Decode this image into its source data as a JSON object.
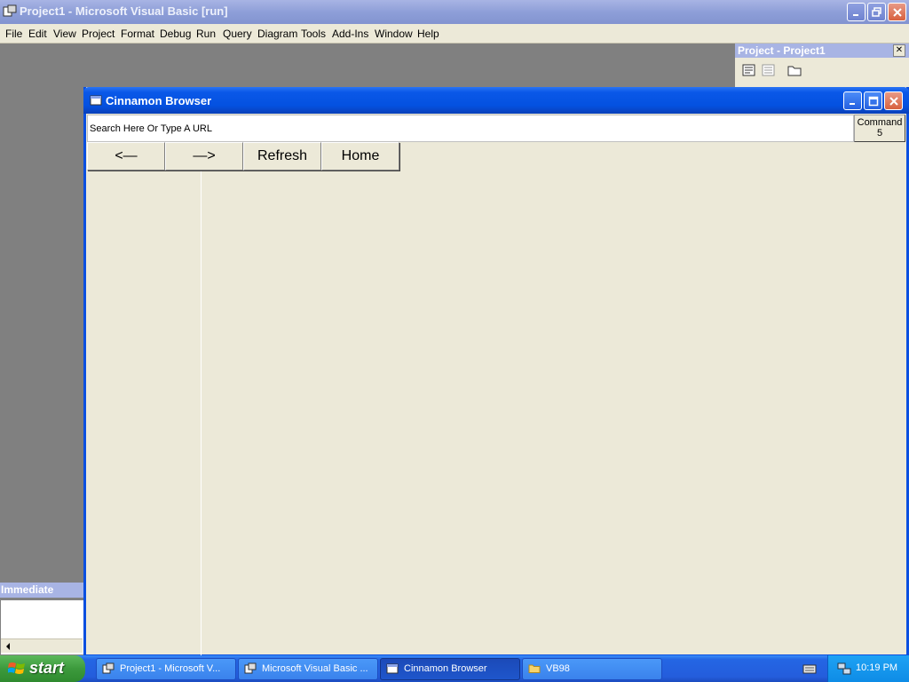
{
  "ide": {
    "title": "Project1 - Microsoft Visual Basic [run]",
    "menu": [
      "File",
      "Edit",
      "View",
      "Project",
      "Format",
      "Debug",
      "Run",
      "Query",
      "Diagram",
      "Tools",
      "Add-Ins",
      "Window",
      "Help"
    ],
    "project_panel_title": "Project - Project1",
    "immediate_title": "Immediate"
  },
  "browser": {
    "title": "Cinnamon Browser",
    "url_placeholder": "Search Here Or Type A URL",
    "command5_label": "Command 5",
    "nav": {
      "back": "<—",
      "forward": "—>",
      "refresh": "Refresh",
      "home": "Home"
    }
  },
  "taskbar": {
    "start_label": "start",
    "tasks": [
      "Project1 - Microsoft V...",
      "Microsoft Visual Basic ...",
      "Cinnamon Browser",
      "VB98"
    ],
    "clock": "10:19 PM"
  },
  "colors": {
    "window_blue": "#0451e0",
    "face": "#ece9d8",
    "start_green": "#3c9a3c"
  }
}
